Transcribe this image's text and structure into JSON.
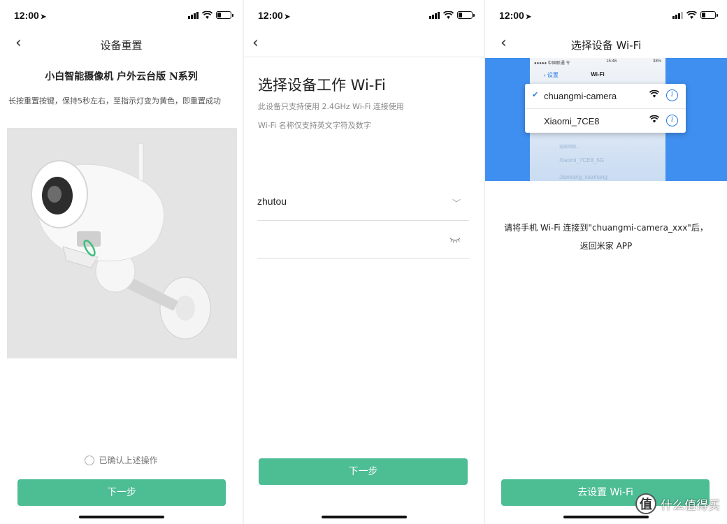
{
  "status_bar": {
    "time": "12:00",
    "location_arrow": "location-arrow-icon"
  },
  "panel1": {
    "nav_title": "设备重置",
    "product_name": "小白智能摄像机 户外云台版 N系列",
    "description": "长按重置按键，保持5秒左右，至指示灯变为黄色，即重置成功",
    "confirm_label": "已确认上述操作",
    "next_button": "下一步"
  },
  "panel2": {
    "heading": "选择设备工作 Wi-Fi",
    "note1": "此设备只支持使用 2.4GHz Wi-Fi 连接使用",
    "note2": "Wi-Fi 名称仅支持英文字符及数字",
    "wifi_name": "zhutou",
    "password_value": "",
    "next_button": "下一步"
  },
  "panel3": {
    "nav_title": "选择设备 Wi-Fi",
    "ios_carrier": "●●●●● 中国联通 令",
    "ios_time": "15:46",
    "ios_battery": "38%",
    "ios_back": "设置",
    "ios_title": "Wi-Fi",
    "networks": [
      {
        "name": "chuangmi-camera",
        "selected": true
      },
      {
        "name": "Xiaomi_7CE8",
        "selected": false
      }
    ],
    "faint_section": "选取网络...",
    "faint_net1": "Xiaomi_7CE8_5G",
    "faint_net2": "Jiankang_xiaohang",
    "instruction_line1": "请将手机 Wi-Fi 连接到\"chuangmi-camera_xxx\"后，",
    "instruction_line2": "返回米家 APP",
    "go_button": "去设置 Wi-Fi",
    "watermark_logo": "值",
    "watermark_text": "什么值得买"
  },
  "colors": {
    "primary_green": "#4dbd93",
    "ios_blue": "#2a7ae2",
    "backdrop_blue": "#3f8ff0"
  }
}
